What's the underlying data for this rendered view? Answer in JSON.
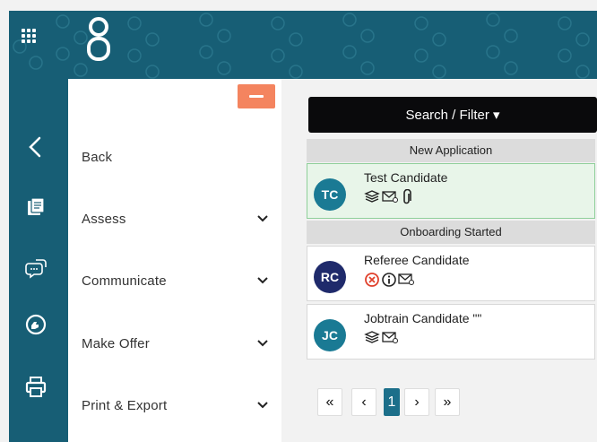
{
  "header": {
    "apps_icon": "apps-grid-icon",
    "logo_icon": "brand-logo-icon"
  },
  "rail": {
    "icons": [
      "back-chevron-icon",
      "assess-icon",
      "communicate-icon",
      "make-offer-icon",
      "print-icon"
    ]
  },
  "menu": {
    "collapse_icon": "minus-icon",
    "items": [
      {
        "label": "Back",
        "has_chevron": false
      },
      {
        "label": "Assess",
        "has_chevron": true
      },
      {
        "label": "Communicate",
        "has_chevron": true
      },
      {
        "label": "Make Offer",
        "has_chevron": true
      },
      {
        "label": "Print & Export",
        "has_chevron": true
      }
    ]
  },
  "search": {
    "label": "Search / Filter ▾"
  },
  "groups": [
    {
      "title": "New Application",
      "candidates": [
        {
          "initials": "TC",
          "name": "Test Candidate",
          "avatar_color": "#1a7a94",
          "icons": [
            "documents-icon",
            "email-icon",
            "attachment-icon"
          ],
          "selected": true
        }
      ]
    },
    {
      "title": "Onboarding Started",
      "candidates": [
        {
          "initials": "RC",
          "name": "Referee Candidate",
          "avatar_color": "#1f2a6b",
          "icons": [
            "cancel-circle-icon",
            "info-circle-icon",
            "email-icon"
          ],
          "selected": false
        },
        {
          "initials": "JC",
          "name": "Jobtrain Candidate \"\"",
          "avatar_color": "#1a7a94",
          "icons": [
            "documents-icon",
            "email-icon"
          ],
          "selected": false
        }
      ]
    }
  ],
  "pagination": {
    "first": "«",
    "prev": "‹",
    "current": "1",
    "next": "›",
    "last": "»"
  },
  "colors": {
    "brand": "#175e75",
    "accent": "#f4845f",
    "active_page": "#1c6f8a",
    "selected_row": "#e8f5e9"
  }
}
